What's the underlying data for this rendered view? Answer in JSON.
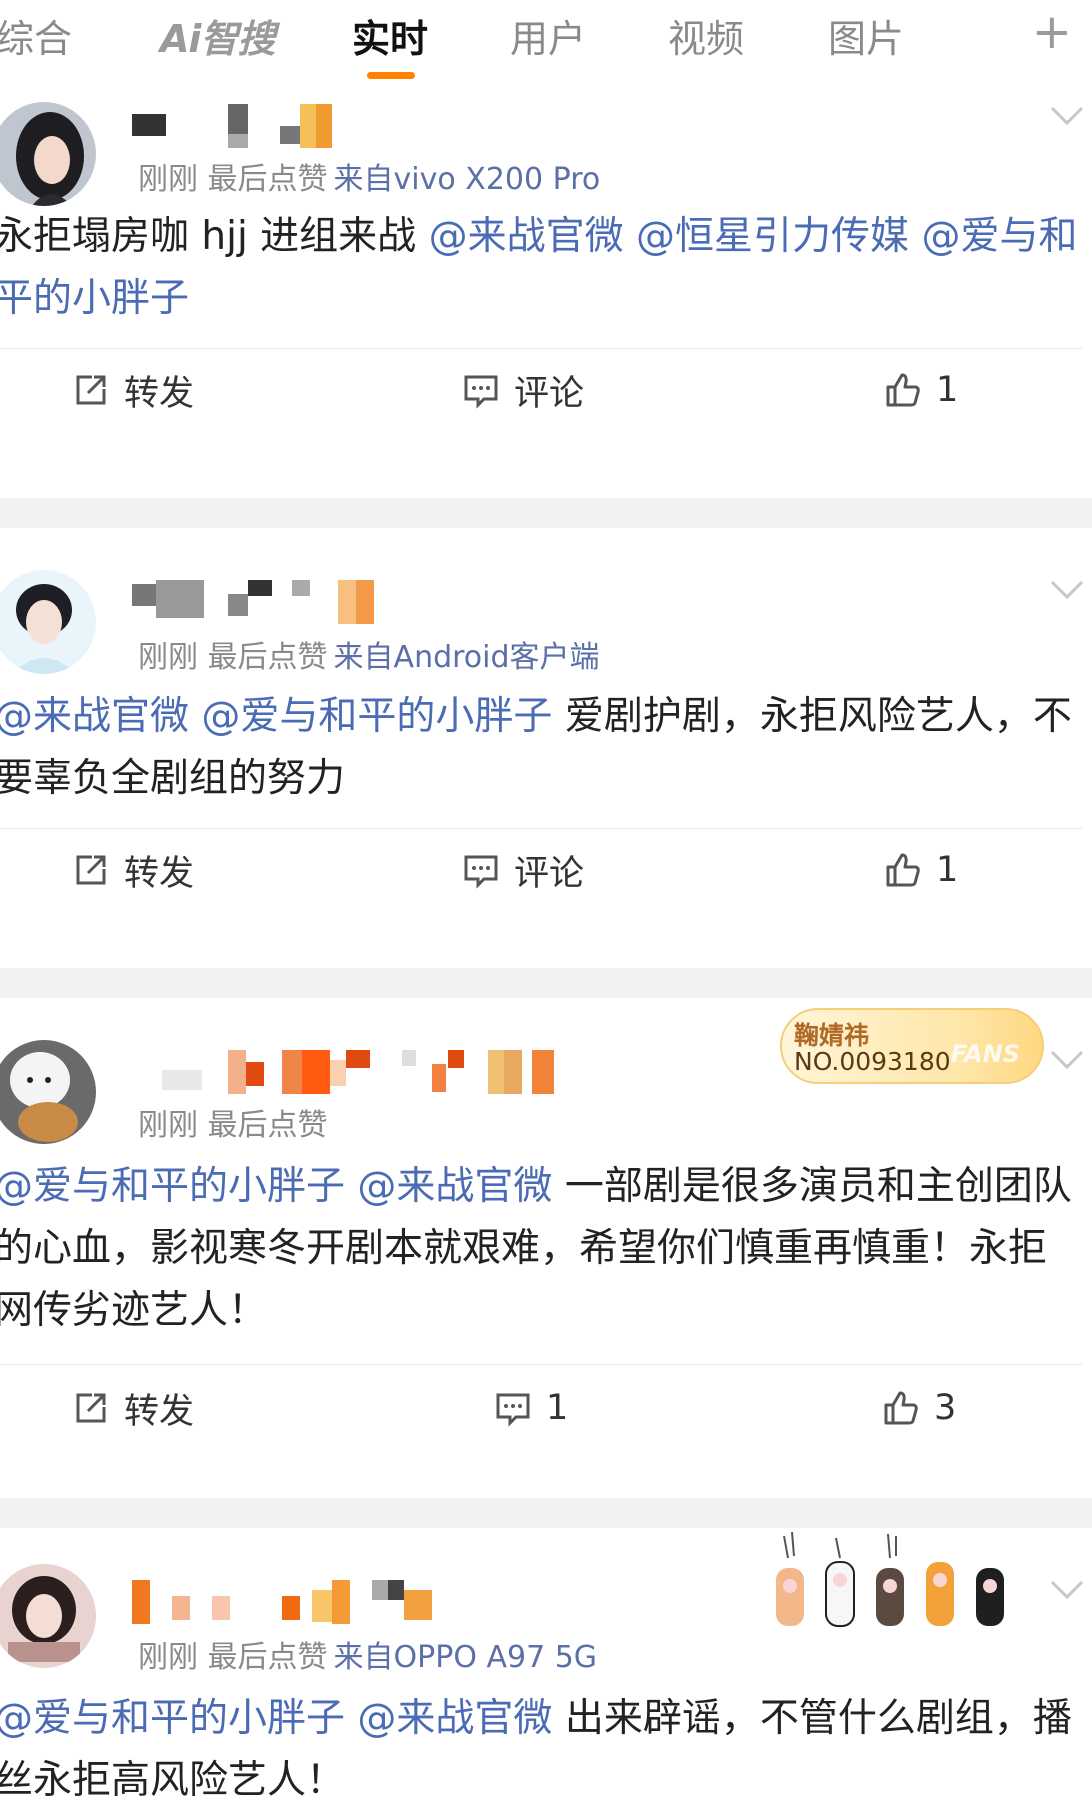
{
  "tabs": {
    "items": [
      "综合",
      "Ai智搜",
      "实时",
      "用户",
      "视频",
      "图片"
    ],
    "active": "实时",
    "add_icon": "plus-icon"
  },
  "colors": {
    "accent": "#ff8200",
    "mention": "#4b6cb5",
    "meta": "#8a8a8a",
    "separator": "#f2f2f2"
  },
  "posts": [
    {
      "meta_prefix": "刚刚 最后点赞",
      "source": "来自vivo X200 Pro",
      "segments": [
        {
          "t": "永拒塌房咖 hjj 进组来战 ",
          "m": false
        },
        {
          "t": "@来战官微",
          "m": true
        },
        {
          "t": " ",
          "m": false
        },
        {
          "t": "@恒星引力传媒",
          "m": true
        },
        {
          "t": " ",
          "m": false
        },
        {
          "t": "@爱与和平的小胖子",
          "m": true
        }
      ],
      "repost": "转发",
      "comment": "评论",
      "likes": "1"
    },
    {
      "meta_prefix": "刚刚 最后点赞",
      "source": "来自Android客户端",
      "segments": [
        {
          "t": "@来战官微",
          "m": true
        },
        {
          "t": " ",
          "m": false
        },
        {
          "t": "@爱与和平的小胖子",
          "m": true
        },
        {
          "t": " 爱剧护剧，永拒风险艺人，不要辜负全剧组的努力",
          "m": false
        }
      ],
      "repost": "转发",
      "comment": "评论",
      "likes": "1"
    },
    {
      "meta_prefix": "刚刚 最后点赞",
      "source": "",
      "fans_badge": {
        "name": "鞠婧祎",
        "no": "NO.0093180",
        "fans": "FANS"
      },
      "segments": [
        {
          "t": "@爱与和平的小胖子",
          "m": true
        },
        {
          "t": " ",
          "m": false
        },
        {
          "t": "@来战官微",
          "m": true
        },
        {
          "t": " 一部剧是很多演员和主创团队的心血，影视寒冬开剧本就艰难，希望你们慎重再慎重！永拒网传劣迹艺人！",
          "m": false
        }
      ],
      "repost": "转发",
      "comment": "1",
      "likes": "3"
    },
    {
      "meta_prefix": "刚刚 最后点赞",
      "source": "来自OPPO A97 5G",
      "segments": [
        {
          "t": "@爱与和平的小胖子",
          "m": true
        },
        {
          "t": " ",
          "m": false
        },
        {
          "t": "@来战官微",
          "m": true
        },
        {
          "t": " 出来辟谣，不管什么剧组，播丝永拒高风险艺人！",
          "m": false
        }
      ]
    }
  ],
  "icons": {
    "repost": "share-icon",
    "comment": "comment-icon",
    "like": "thumbs-up-icon",
    "more": "chevron-down-icon"
  }
}
